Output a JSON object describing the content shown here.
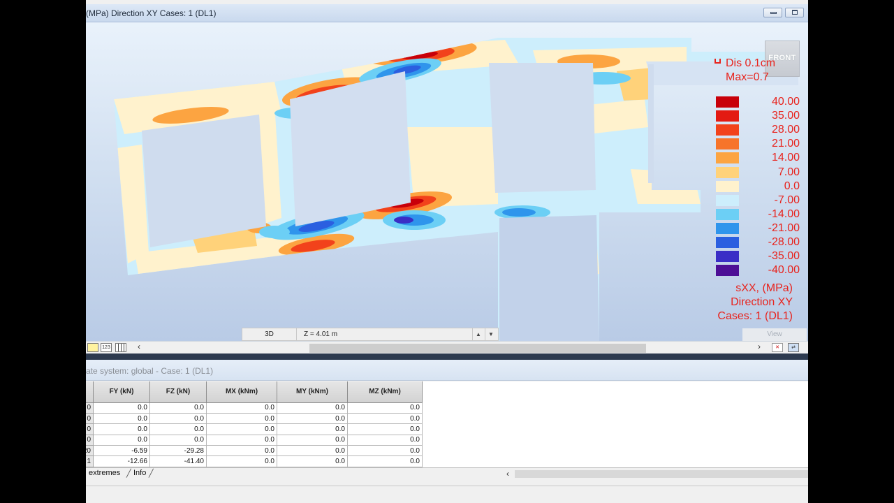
{
  "window": {
    "title": "(MPa) Direction XY Cases: 1 (DL1)"
  },
  "viewport": {
    "view_cube_label": "FRONT",
    "legend": {
      "dis_label": "Dis  0.1cm",
      "max_label": "Max=0.7",
      "levels": [
        {
          "value": "40.00",
          "color": "#c8000a"
        },
        {
          "value": "35.00",
          "color": "#e31a12"
        },
        {
          "value": "28.00",
          "color": "#f2421b"
        },
        {
          "value": "21.00",
          "color": "#f7742a"
        },
        {
          "value": "14.00",
          "color": "#fca441"
        },
        {
          "value": "7.00",
          "color": "#ffd27a"
        },
        {
          "value": "0.0",
          "color": "#fff2cd"
        },
        {
          "value": "-7.00",
          "color": "#cdeefc"
        },
        {
          "value": "-14.00",
          "color": "#6ccff5"
        },
        {
          "value": "-21.00",
          "color": "#2f95ec"
        },
        {
          "value": "-28.00",
          "color": "#2b5fe0"
        },
        {
          "value": "-35.00",
          "color": "#3a2ec6"
        },
        {
          "value": "-40.00",
          "color": "#4d0f96"
        }
      ],
      "caption_1": "sXX, (MPa)",
      "caption_2": "Direction XY",
      "caption_3": "Cases: 1 (DL1)"
    },
    "zbar": {
      "mode": "3D",
      "z_value": "Z = 4.01 m"
    },
    "view_label": "View",
    "toolbar_icons": [
      "layer-icon",
      "number-icon",
      "grid-icon"
    ]
  },
  "results_panel": {
    "title": "ate system: global - Case: 1 (DL1)",
    "columns": [
      "FY (kN)",
      "FZ (kN)",
      "MX (kNm)",
      "MY (kNm)",
      "MZ (kNm)"
    ],
    "rows": [
      {
        "rn": "0",
        "cells": [
          "0.0",
          "0.0",
          "0.0",
          "0.0",
          "0.0"
        ]
      },
      {
        "rn": "0",
        "cells": [
          "0.0",
          "0.0",
          "0.0",
          "0.0",
          "0.0"
        ]
      },
      {
        "rn": "0",
        "cells": [
          "0.0",
          "0.0",
          "0.0",
          "0.0",
          "0.0"
        ]
      },
      {
        "rn": "0",
        "cells": [
          "0.0",
          "0.0",
          "0.0",
          "0.0",
          "0.0"
        ]
      },
      {
        "rn": "20",
        "cells": [
          "-6.59",
          "-29.28",
          "0.0",
          "0.0",
          "0.0"
        ]
      },
      {
        "rn": "1",
        "cells": [
          "-12.66",
          "-41.40",
          "0.0",
          "0.0",
          "0.0"
        ]
      }
    ],
    "tabs": [
      "extremes",
      "Info"
    ]
  }
}
